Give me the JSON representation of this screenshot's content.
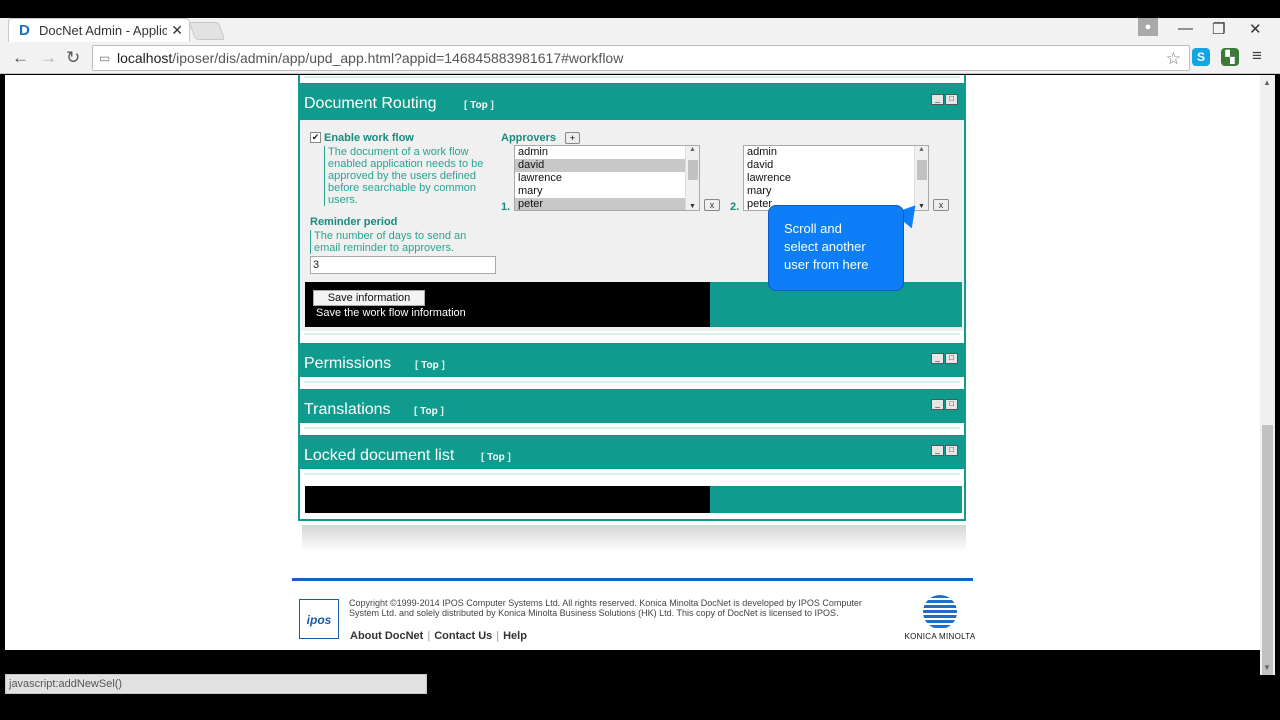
{
  "browser": {
    "tab_title": "DocNet Admin - Applic...",
    "tab_favicon": "D",
    "tab_close": "✕",
    "url_host": "localhost",
    "url_rest": "/iposer/dis/admin/app/upd_app.html?appid=146845883981617#workflow",
    "status_text": "javascript:addNewSel()"
  },
  "document_routing": {
    "title": "Document Routing",
    "top_link": "Top",
    "enable_workflow_label": "Enable work flow",
    "enable_workflow_checked": true,
    "enable_workflow_desc": "The document of a work flow enabled application needs to be approved by the users defined before searchable by common users.",
    "reminder_label": "Reminder period",
    "reminder_desc": "The number of days to send an email reminder to approvers.",
    "reminder_value": "3",
    "approvers_label": "Approvers",
    "list1_index": "1.",
    "list2_index": "2.",
    "list1_options": [
      {
        "label": "admin",
        "selected": false
      },
      {
        "label": "david",
        "selected": true
      },
      {
        "label": "lawrence",
        "selected": false
      },
      {
        "label": "mary",
        "selected": false
      },
      {
        "label": "peter",
        "selected": true
      }
    ],
    "list2_options": [
      {
        "label": "admin",
        "selected": false
      },
      {
        "label": "david",
        "selected": false
      },
      {
        "label": "lawrence",
        "selected": false
      },
      {
        "label": "mary",
        "selected": false
      },
      {
        "label": "peter",
        "selected": false
      }
    ],
    "remove_label": "x",
    "add_label": "+",
    "save_button": "Save information",
    "save_desc": "Save the work flow information"
  },
  "callout": {
    "line1": "Scroll and",
    "line2": "select another",
    "line3": "user from here"
  },
  "permissions": {
    "title": "Permissions",
    "top_link": "Top"
  },
  "translations": {
    "title": "Translations",
    "top_link": "Top"
  },
  "locked": {
    "title": "Locked document list",
    "top_link": "Top"
  },
  "footer": {
    "logo_text": "ipos",
    "copyright": "Copyright ©1999-2014 IPOS Computer Systems Ltd. All rights reserved. Konica Minolta DocNet is developed by IPOS Computer System Ltd. and solely distributed by Konica Minolta Business Solutions (HK) Ltd. This copy of DocNet is licensed to IPOS.",
    "about": "About DocNet",
    "contact": "Contact Us",
    "help": "Help",
    "brand": "KONICA MINOLTA"
  }
}
